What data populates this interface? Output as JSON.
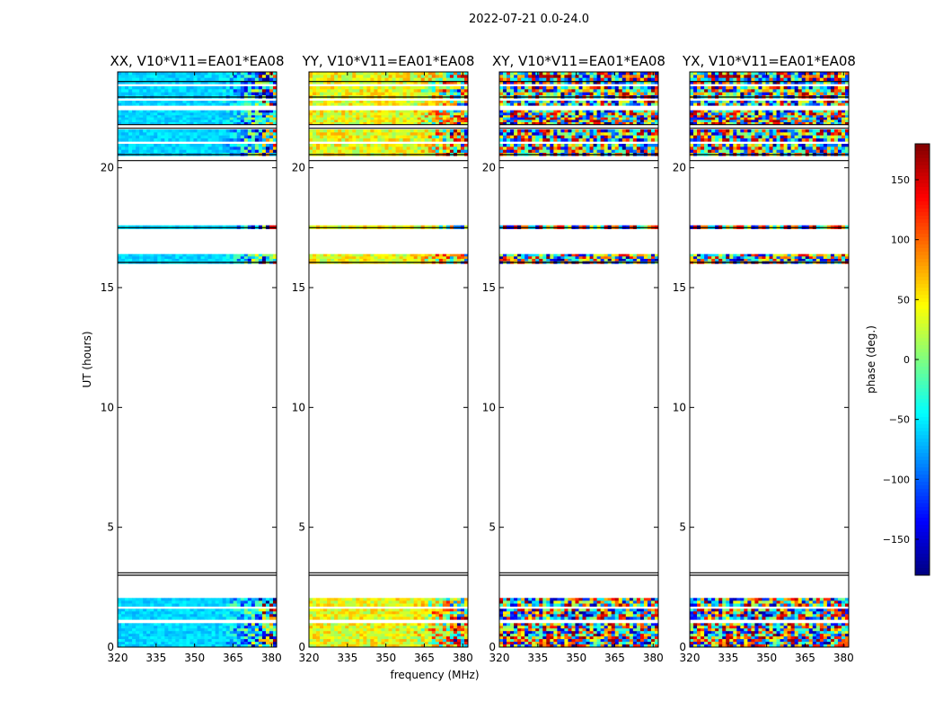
{
  "figure": {
    "suptitle": "2022-07-21 0.0-24.0",
    "xlabel": "frequency (MHz)",
    "ylabel": "UT (hours)"
  },
  "chart_data": {
    "type": "heatmap",
    "panels": [
      {
        "title": "XX, V10*V11=EA01*EA08",
        "base_phase": -60,
        "variation": 30
      },
      {
        "title": "YY, V10*V11=EA01*EA08",
        "base_phase": 40,
        "variation": 70
      },
      {
        "title": "XY, V10*V11=EA01*EA08",
        "base_phase": 0,
        "variation": 180
      },
      {
        "title": "YX, V10*V11=EA01*EA08",
        "base_phase": 0,
        "variation": 180
      }
    ],
    "xlim": [
      320,
      382
    ],
    "xticks": [
      320,
      335,
      350,
      365,
      380
    ],
    "ylim": [
      0,
      24
    ],
    "yticks": [
      0,
      5,
      10,
      15,
      20
    ],
    "data_bands_hours": [
      [
        0.0,
        1.0
      ],
      [
        1.15,
        1.6
      ],
      [
        1.7,
        2.05
      ],
      [
        16.0,
        16.4
      ],
      [
        17.45,
        17.6
      ],
      [
        20.5,
        21.0
      ],
      [
        21.1,
        21.6
      ],
      [
        21.8,
        22.2
      ],
      [
        22.2,
        22.4
      ],
      [
        22.6,
        22.8
      ],
      [
        22.9,
        23.4
      ],
      [
        23.5,
        24.0
      ]
    ],
    "separator_lines_hours": [
      3.0,
      3.1,
      16.05,
      17.5,
      20.3,
      20.55,
      21.65,
      21.8,
      22.95,
      23.6
    ],
    "colorbar": {
      "label": "phase (deg.)",
      "range": [
        -180,
        180
      ],
      "ticks": [
        150,
        100,
        50,
        0,
        -50,
        -100,
        -150
      ],
      "tick_labels": [
        "150",
        "100",
        "50",
        "0",
        "−50",
        "−100",
        "−150"
      ],
      "colormap": "jet"
    }
  }
}
